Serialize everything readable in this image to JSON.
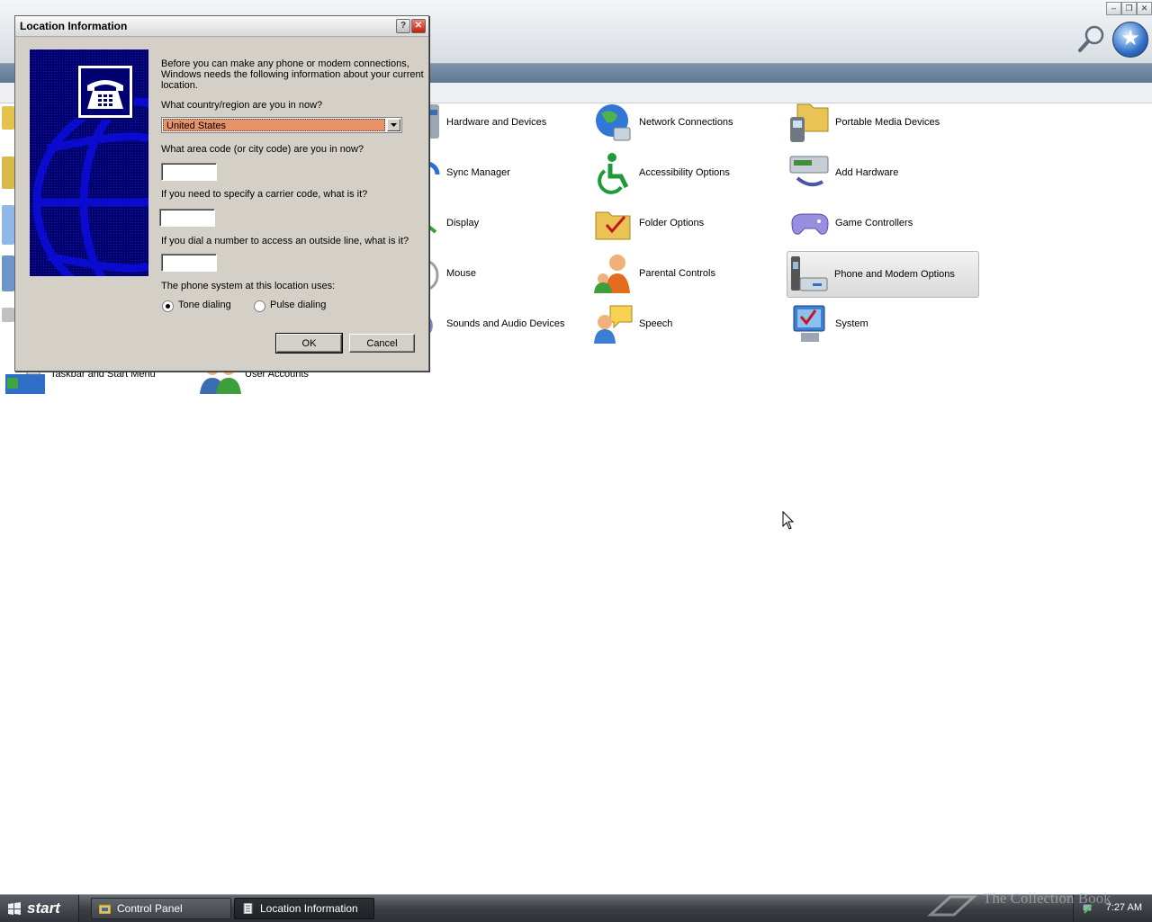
{
  "control_panel": {
    "items": [
      {
        "label": "Hardware and Devices",
        "icon": "hardware-devices-icon"
      },
      {
        "label": "Network Connections",
        "icon": "network-connections-icon"
      },
      {
        "label": "Portable Media Devices",
        "icon": "portable-media-icon"
      },
      {
        "label": "Sync Manager",
        "icon": "sync-manager-icon"
      },
      {
        "label": "Accessibility Options",
        "icon": "accessibility-icon"
      },
      {
        "label": "Add Hardware",
        "icon": "add-hardware-icon"
      },
      {
        "label": "Display",
        "icon": "display-icon"
      },
      {
        "label": "Folder Options",
        "icon": "folder-options-icon"
      },
      {
        "label": "Game Controllers",
        "icon": "game-controllers-icon"
      },
      {
        "label": "Mouse",
        "icon": "mouse-icon"
      },
      {
        "label": "Parental Controls",
        "icon": "parental-controls-icon"
      },
      {
        "label": "Phone and Modem Options",
        "icon": "phone-modem-icon",
        "selected": true
      },
      {
        "label": "Sounds and Audio Devices",
        "icon": "sounds-icon"
      },
      {
        "label": "Speech",
        "icon": "speech-icon"
      },
      {
        "label": "System",
        "icon": "system-icon"
      },
      {
        "label": "Taskbar and Start Menu",
        "icon": "taskbar-start-icon"
      },
      {
        "label": "User Accounts",
        "icon": "user-accounts-icon"
      }
    ]
  },
  "dialog": {
    "title": "Location Information",
    "help_label": "?",
    "close_label": "✕",
    "intro_line1": "Before you can make any phone or modem connections,",
    "intro_line2": "Windows needs the following information about your current",
    "intro_line3": "location.",
    "country_question": "What country/region are you in now?",
    "country_value": "United States",
    "area_code_question": "What area code (or city code) are you in now?",
    "area_code_value": "",
    "carrier_question": "If you need to specify a carrier code, what is it?",
    "carrier_value": "",
    "outside_line_question": "If you dial a number to access an outside line, what is it?",
    "outside_line_value": "",
    "phone_system_question": "The phone system at this location uses:",
    "tone_label": "Tone dialing",
    "pulse_label": "Pulse dialing",
    "selected_dialing": "tone",
    "ok_label": "OK",
    "cancel_label": "Cancel"
  },
  "taskbar": {
    "start_label": "start",
    "tasks": [
      {
        "label": "Control Panel",
        "icon": "control-panel-icon"
      },
      {
        "label": "Location Information",
        "icon": "document-icon",
        "active": true
      }
    ],
    "clock": "7:27 AM"
  },
  "watermark": "The Collection Book",
  "colors": {
    "dialog_bg": "#d4d0c8",
    "dialog_art_bg": "#000070",
    "selection": "#e8926a",
    "taskbar": "#3b3f44"
  }
}
